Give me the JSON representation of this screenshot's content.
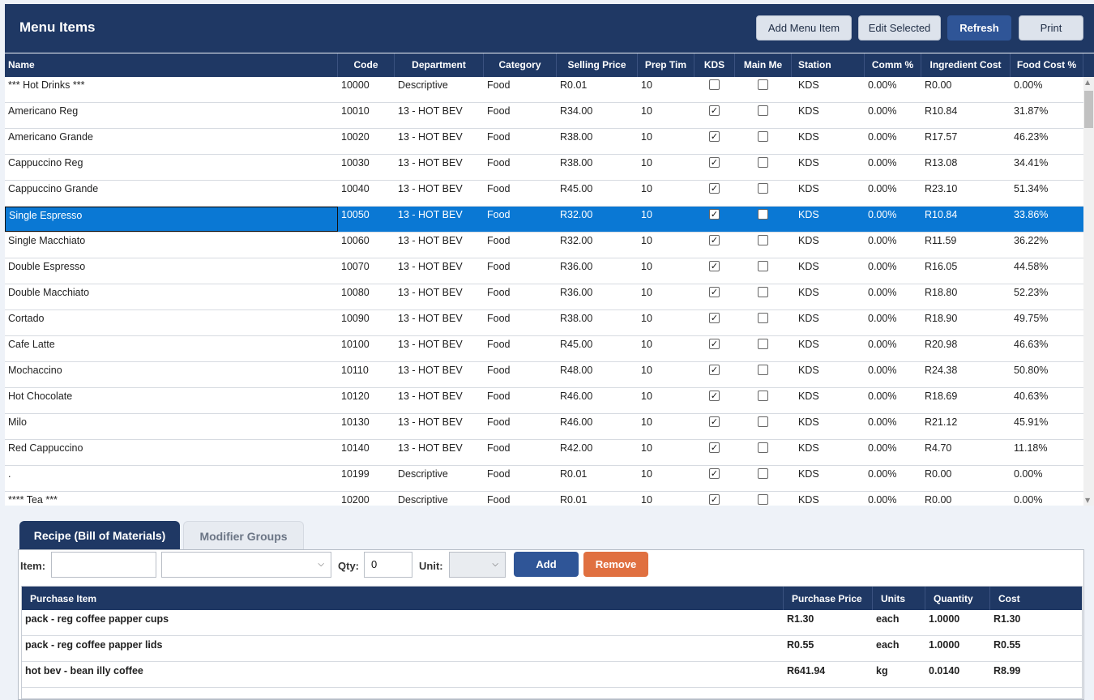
{
  "header": {
    "title": "Menu Items",
    "buttons": {
      "add": "Add Menu Item",
      "edit": "Edit Selected",
      "refresh": "Refresh",
      "print": "Print"
    }
  },
  "grid": {
    "columns": [
      "Name",
      "Code",
      "Department",
      "Category",
      "Selling Price",
      "Prep Tim",
      "KDS",
      "Main Me",
      "Station",
      "Comm %",
      "Ingredient Cost",
      "Food Cost %"
    ],
    "rows": [
      {
        "name": "*** Hot Drinks ***",
        "code": "10000",
        "department": "Descriptive",
        "category": "Food",
        "selling_price": "R0.01",
        "prep_time": "10",
        "kds": false,
        "main_menu": false,
        "station": "KDS",
        "comm": "0.00%",
        "ingredient_cost": "R0.00",
        "food_cost": "0.00%"
      },
      {
        "name": "Americano Reg",
        "code": "10010",
        "department": "13 - HOT BEV",
        "category": "Food",
        "selling_price": "R34.00",
        "prep_time": "10",
        "kds": true,
        "main_menu": false,
        "station": "KDS",
        "comm": "0.00%",
        "ingredient_cost": "R10.84",
        "food_cost": "31.87%"
      },
      {
        "name": "Americano Grande",
        "code": "10020",
        "department": "13 - HOT BEV",
        "category": "Food",
        "selling_price": "R38.00",
        "prep_time": "10",
        "kds": true,
        "main_menu": false,
        "station": "KDS",
        "comm": "0.00%",
        "ingredient_cost": "R17.57",
        "food_cost": "46.23%"
      },
      {
        "name": "Cappuccino Reg",
        "code": "10030",
        "department": "13 - HOT BEV",
        "category": "Food",
        "selling_price": "R38.00",
        "prep_time": "10",
        "kds": true,
        "main_menu": false,
        "station": "KDS",
        "comm": "0.00%",
        "ingredient_cost": "R13.08",
        "food_cost": "34.41%"
      },
      {
        "name": "Cappuccino Grande",
        "code": "10040",
        "department": "13 - HOT BEV",
        "category": "Food",
        "selling_price": "R45.00",
        "prep_time": "10",
        "kds": true,
        "main_menu": false,
        "station": "KDS",
        "comm": "0.00%",
        "ingredient_cost": "R23.10",
        "food_cost": "51.34%"
      },
      {
        "name": "Single Espresso",
        "code": "10050",
        "department": "13 - HOT BEV",
        "category": "Food",
        "selling_price": "R32.00",
        "prep_time": "10",
        "kds": true,
        "main_menu": false,
        "station": "KDS",
        "comm": "0.00%",
        "ingredient_cost": "R10.84",
        "food_cost": "33.86%",
        "selected": true
      },
      {
        "name": "Single Macchiato",
        "code": "10060",
        "department": "13 - HOT BEV",
        "category": "Food",
        "selling_price": "R32.00",
        "prep_time": "10",
        "kds": true,
        "main_menu": false,
        "station": "KDS",
        "comm": "0.00%",
        "ingredient_cost": "R11.59",
        "food_cost": "36.22%"
      },
      {
        "name": "Double Espresso",
        "code": "10070",
        "department": "13 - HOT BEV",
        "category": "Food",
        "selling_price": "R36.00",
        "prep_time": "10",
        "kds": true,
        "main_menu": false,
        "station": "KDS",
        "comm": "0.00%",
        "ingredient_cost": "R16.05",
        "food_cost": "44.58%"
      },
      {
        "name": "Double Macchiato",
        "code": "10080",
        "department": "13 - HOT BEV",
        "category": "Food",
        "selling_price": "R36.00",
        "prep_time": "10",
        "kds": true,
        "main_menu": false,
        "station": "KDS",
        "comm": "0.00%",
        "ingredient_cost": "R18.80",
        "food_cost": "52.23%"
      },
      {
        "name": "Cortado",
        "code": "10090",
        "department": "13 - HOT BEV",
        "category": "Food",
        "selling_price": "R38.00",
        "prep_time": "10",
        "kds": true,
        "main_menu": false,
        "station": "KDS",
        "comm": "0.00%",
        "ingredient_cost": "R18.90",
        "food_cost": "49.75%"
      },
      {
        "name": "Cafe Latte",
        "code": "10100",
        "department": "13 - HOT BEV",
        "category": "Food",
        "selling_price": "R45.00",
        "prep_time": "10",
        "kds": true,
        "main_menu": false,
        "station": "KDS",
        "comm": "0.00%",
        "ingredient_cost": "R20.98",
        "food_cost": "46.63%"
      },
      {
        "name": "Mochaccino",
        "code": "10110",
        "department": "13 - HOT BEV",
        "category": "Food",
        "selling_price": "R48.00",
        "prep_time": "10",
        "kds": true,
        "main_menu": false,
        "station": "KDS",
        "comm": "0.00%",
        "ingredient_cost": "R24.38",
        "food_cost": "50.80%"
      },
      {
        "name": "Hot Chocolate",
        "code": "10120",
        "department": "13 - HOT BEV",
        "category": "Food",
        "selling_price": "R46.00",
        "prep_time": "10",
        "kds": true,
        "main_menu": false,
        "station": "KDS",
        "comm": "0.00%",
        "ingredient_cost": "R18.69",
        "food_cost": "40.63%"
      },
      {
        "name": "Milo",
        "code": "10130",
        "department": "13 - HOT BEV",
        "category": "Food",
        "selling_price": "R46.00",
        "prep_time": "10",
        "kds": true,
        "main_menu": false,
        "station": "KDS",
        "comm": "0.00%",
        "ingredient_cost": "R21.12",
        "food_cost": "45.91%"
      },
      {
        "name": "Red Cappuccino",
        "code": "10140",
        "department": "13 - HOT BEV",
        "category": "Food",
        "selling_price": "R42.00",
        "prep_time": "10",
        "kds": true,
        "main_menu": false,
        "station": "KDS",
        "comm": "0.00%",
        "ingredient_cost": "R4.70",
        "food_cost": "11.18%"
      },
      {
        "name": ".",
        "code": "10199",
        "department": "Descriptive",
        "category": "Food",
        "selling_price": "R0.01",
        "prep_time": "10",
        "kds": true,
        "main_menu": false,
        "station": "KDS",
        "comm": "0.00%",
        "ingredient_cost": "R0.00",
        "food_cost": "0.00%"
      },
      {
        "name": "**** Tea ***",
        "code": "10200",
        "department": "Descriptive",
        "category": "Food",
        "selling_price": "R0.01",
        "prep_time": "10",
        "kds": true,
        "main_menu": false,
        "station": "KDS",
        "comm": "0.00%",
        "ingredient_cost": "R0.00",
        "food_cost": "0.00%"
      }
    ]
  },
  "tabs": {
    "recipe": "Recipe (Bill of Materials)",
    "modifiers": "Modifier Groups"
  },
  "form": {
    "item_label": "Item:",
    "item_value": "",
    "qty_label": "Qty:",
    "qty_value": "0",
    "unit_label": "Unit:",
    "add_label": "Add",
    "remove_label": "Remove"
  },
  "recipe": {
    "columns": [
      "Purchase Item",
      "Purchase Price",
      "Units",
      "Quantity",
      "Cost"
    ],
    "rows": [
      {
        "item": "pack - reg coffee papper cups",
        "price": "R1.30",
        "units": "each",
        "quantity": "1.0000",
        "cost": "R1.30"
      },
      {
        "item": "pack - reg coffee papper lids",
        "price": "R0.55",
        "units": "each",
        "quantity": "1.0000",
        "cost": "R0.55"
      },
      {
        "item": "hot bev  - bean illy coffee",
        "price": "R641.94",
        "units": "kg",
        "quantity": "0.0140",
        "cost": "R8.99"
      }
    ]
  },
  "colors": {
    "navy": "#1f3864",
    "primary": "#2f5597",
    "selected": "#0a78d4",
    "danger": "#e07040"
  }
}
